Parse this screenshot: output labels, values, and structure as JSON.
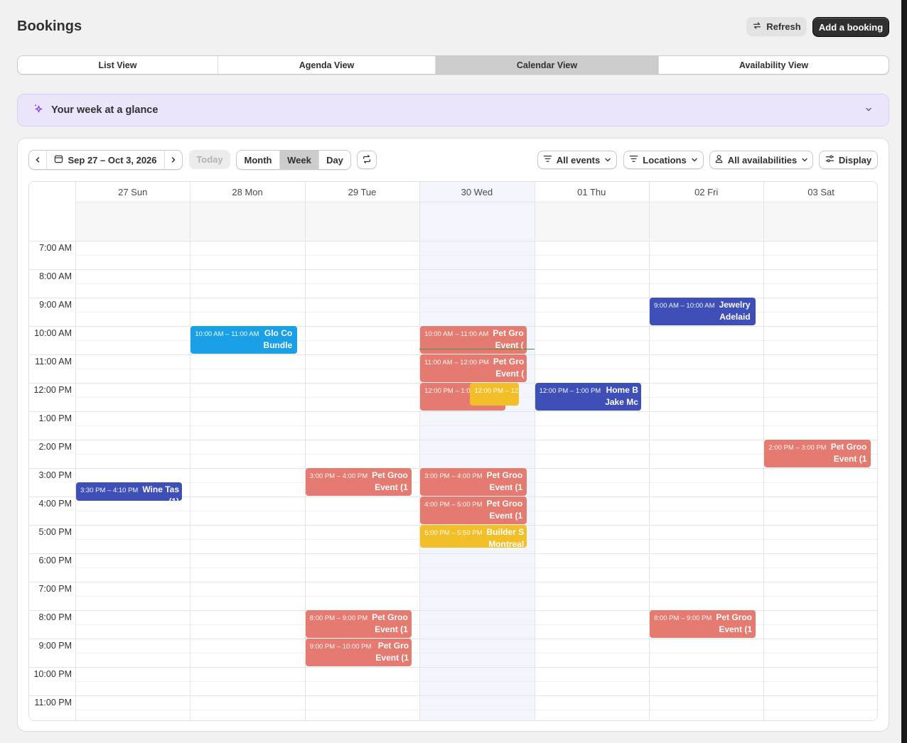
{
  "header": {
    "title": "Bookings",
    "refresh_label": "Refresh",
    "add_label": "Add a booking"
  },
  "view_tabs": [
    {
      "label": "List View",
      "active": false
    },
    {
      "label": "Agenda View",
      "active": false
    },
    {
      "label": "Calendar View",
      "active": true
    },
    {
      "label": "Availability View",
      "active": false
    }
  ],
  "glance": {
    "title": "Your week at a glance"
  },
  "toolbar": {
    "date_range": "Sep 27 – Oct 3, 2026",
    "today_label": "Today",
    "modes": [
      {
        "label": "Month",
        "active": false
      },
      {
        "label": "Week",
        "active": true
      },
      {
        "label": "Day",
        "active": false
      }
    ],
    "filters": {
      "events": "All events",
      "locations": "Locations",
      "availabilities": "All availabilities",
      "display": "Display"
    }
  },
  "calendar": {
    "days": [
      "27 Sun",
      "28 Mon",
      "29 Tue",
      "30 Wed",
      "01 Thu",
      "02 Fri",
      "03 Sat"
    ],
    "today_index": 3,
    "hours": [
      "7:00 AM",
      "8:00 AM",
      "9:00 AM",
      "10:00 AM",
      "11:00 AM",
      "12:00 PM",
      "1:00 PM",
      "2:00 PM",
      "3:00 PM",
      "4:00 PM",
      "5:00 PM",
      "6:00 PM",
      "7:00 PM",
      "8:00 PM",
      "9:00 PM",
      "10:00 PM",
      "11:00 PM"
    ],
    "colors": {
      "coral": "#e57a71",
      "indigo": "#3f4fb8",
      "blue": "#1aa0e6",
      "yellow": "#f2bf29"
    },
    "events": [
      {
        "day": 0,
        "start": 15.5,
        "end": 16.17,
        "time": "3:30 PM – 4:10 PM",
        "title": "Wine Tas",
        "title2": "(1)",
        "color": "indigo"
      },
      {
        "day": 1,
        "start": 10,
        "end": 11,
        "time": "10:00 AM – 11:00 AM",
        "title": "Glo Co",
        "title2": "Bundle",
        "color": "blue"
      },
      {
        "day": 2,
        "start": 15,
        "end": 16,
        "time": "3:00 PM – 4:00 PM",
        "title": "Pet Groo",
        "title2": "Event (1",
        "color": "coral"
      },
      {
        "day": 2,
        "start": 20,
        "end": 21,
        "time": "8:00 PM – 9:00 PM",
        "title": "Pet Groo",
        "title2": "Event (1",
        "color": "coral"
      },
      {
        "day": 2,
        "start": 21,
        "end": 22,
        "time": "9:00 PM – 10:00 PM",
        "title": "Pet Gro",
        "title2": "Event (1",
        "color": "coral"
      },
      {
        "day": 3,
        "start": 10,
        "end": 11,
        "time": "10:00 AM – 11:00 AM",
        "title": "Pet Gro",
        "title2": "Event (",
        "color": "coral"
      },
      {
        "day": 3,
        "start": 11,
        "end": 12,
        "time": "11:00 AM – 12:00 PM",
        "title": "Pet Gro",
        "title2": "Event (",
        "color": "coral"
      },
      {
        "day": 3,
        "start": 12,
        "end": 13,
        "time": "12:00 PM – 1:0",
        "title": "",
        "title2": "",
        "color": "coral",
        "width_frac": 0.8
      },
      {
        "day": 3,
        "start": 12,
        "end": 12.83,
        "time": "12:00 PM – 12:",
        "title": "",
        "title2": "",
        "color": "yellow",
        "left_frac": 0.47,
        "width_frac": 0.46
      },
      {
        "day": 3,
        "start": 15,
        "end": 16,
        "time": "3:00 PM – 4:00 PM",
        "title": "Pet Groo",
        "title2": "Event (1",
        "color": "coral"
      },
      {
        "day": 3,
        "start": 16,
        "end": 17,
        "time": "4:00 PM – 5:00 PM",
        "title": "Pet Groo",
        "title2": "Event (1",
        "color": "coral"
      },
      {
        "day": 3,
        "start": 17,
        "end": 17.83,
        "time": "5:00 PM – 5:50 PM",
        "title": "Builder S",
        "title2": "Montreal",
        "color": "yellow"
      },
      {
        "day": 4,
        "start": 12,
        "end": 13,
        "time": "12:00 PM – 1:00 PM",
        "title": "Home B",
        "title2": "Jake Mc",
        "color": "indigo"
      },
      {
        "day": 5,
        "start": 9,
        "end": 10,
        "time": "9:00 AM – 10:00 AM",
        "title": "Jewelry",
        "title2": "Adelaid",
        "color": "indigo"
      },
      {
        "day": 5,
        "start": 20,
        "end": 21,
        "time": "8:00 PM – 9:00 PM",
        "title": "Pet Groo",
        "title2": "Event (1",
        "color": "coral"
      },
      {
        "day": 6,
        "start": 14,
        "end": 15,
        "time": "2:00 PM – 3:00 PM",
        "title": "Pet Groo",
        "title2": "Event (1",
        "color": "coral"
      }
    ],
    "now": {
      "day": 3,
      "hour": 10.8
    }
  }
}
